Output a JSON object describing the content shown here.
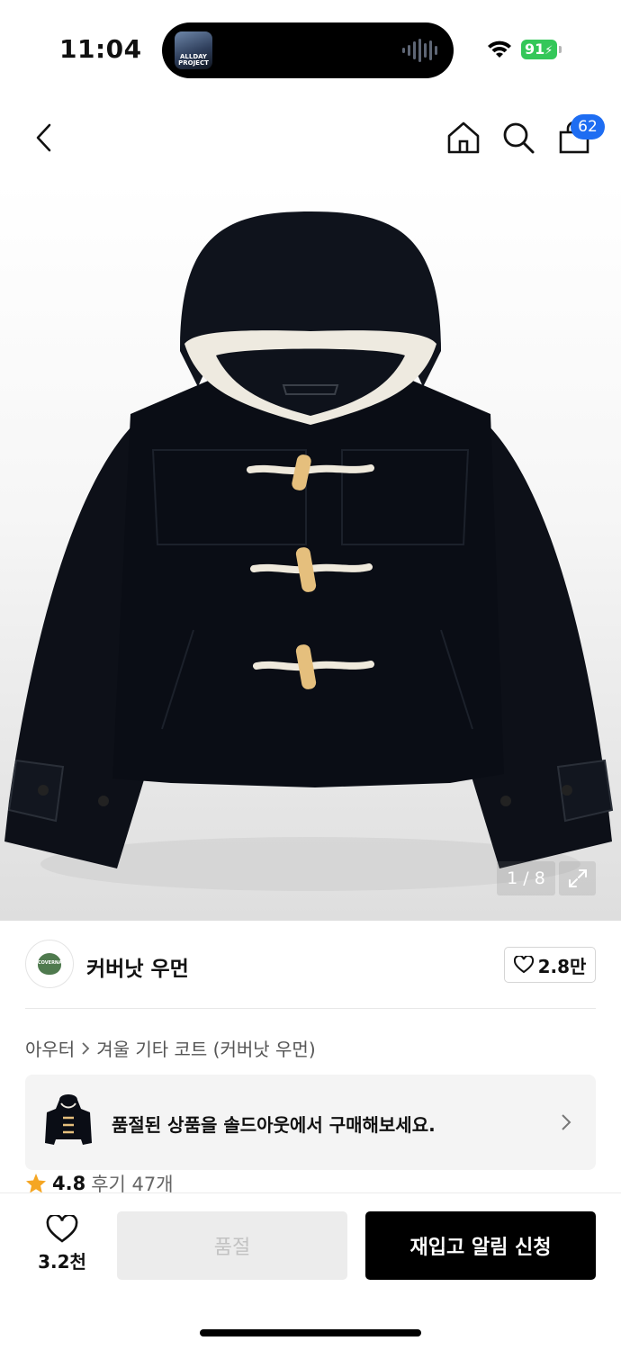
{
  "status_bar": {
    "time": "11:04",
    "island_art_text": "ALLDAY PROJECT",
    "battery": "91"
  },
  "nav": {
    "back_icon": "chevron-left-icon",
    "home_icon": "home-icon",
    "search_icon": "search-icon",
    "cart_icon": "shopping-bag-icon",
    "cart_badge": "62"
  },
  "product_image": {
    "pager": "1 / 8",
    "expand_icon": "expand-icon"
  },
  "brand": {
    "name": "커버낫 우먼",
    "likes": "2.8만"
  },
  "breadcrumb": {
    "category": "아우터",
    "subcategory": "겨울 기타 코트 (커버낫 우먼)"
  },
  "soldout_banner": {
    "text": "품절된 상품을 솔드아웃에서 구매해보세요."
  },
  "rating": {
    "score": "4.8",
    "reviews": "후기 47개"
  },
  "bottom_bar": {
    "wish_count": "3.2천",
    "soldout_label": "품절",
    "restock_label": "재입고 알림 신청"
  },
  "colors": {
    "badge": "#1e6df2",
    "battery": "#34c759",
    "star": "#f5a623",
    "primary_button": "#000000"
  }
}
